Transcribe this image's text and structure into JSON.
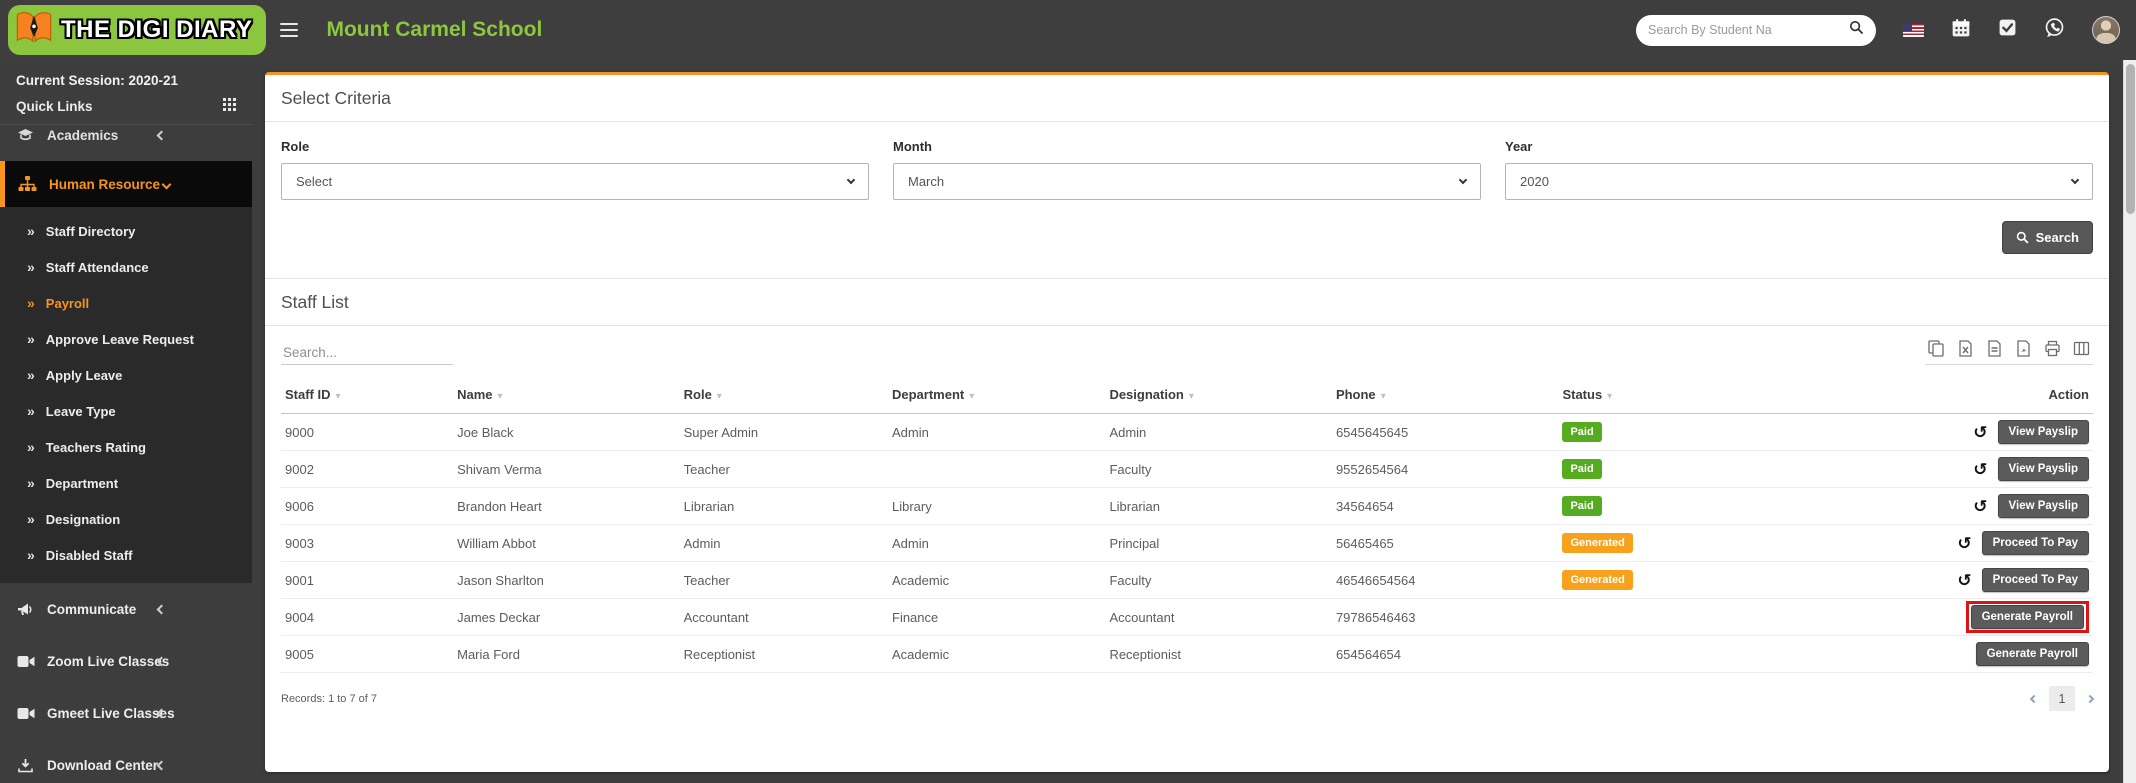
{
  "header": {
    "brand": "THE DIGI DIARY",
    "school": "Mount Carmel School",
    "search_placeholder": "Search By Student Na"
  },
  "sidebar": {
    "session": "Current Session: 2020-21",
    "quick_links": "Quick Links",
    "academics": "Academics",
    "human_resource": "Human Resource",
    "submenu": [
      "Staff Directory",
      "Staff Attendance",
      "Payroll",
      "Approve Leave Request",
      "Apply Leave",
      "Leave Type",
      "Teachers Rating",
      "Department",
      "Designation",
      "Disabled Staff"
    ],
    "bottom": [
      "Communicate",
      "Zoom Live Classes",
      "Gmeet Live Classes",
      "Download Center"
    ]
  },
  "criteria": {
    "title": "Select Criteria",
    "fields": [
      {
        "label": "Role",
        "value": "Select"
      },
      {
        "label": "Month",
        "value": "March"
      },
      {
        "label": "Year",
        "value": "2020"
      }
    ],
    "search_button": "Search"
  },
  "staff": {
    "title": "Staff List",
    "search_placeholder": "Search...",
    "columns": [
      "Staff ID",
      "Name",
      "Role",
      "Department",
      "Designation",
      "Phone",
      "Status",
      "Action"
    ],
    "rows": [
      {
        "id": "9000",
        "name": "Joe Black",
        "role": "Super Admin",
        "department": "Admin",
        "designation": "Admin",
        "phone": "6545645645",
        "status": "Paid",
        "action": "View Payslip"
      },
      {
        "id": "9002",
        "name": "Shivam Verma",
        "role": "Teacher",
        "department": "",
        "designation": "Faculty",
        "phone": "9552654564",
        "status": "Paid",
        "action": "View Payslip"
      },
      {
        "id": "9006",
        "name": "Brandon Heart",
        "role": "Librarian",
        "department": "Library",
        "designation": "Librarian",
        "phone": "34564654",
        "status": "Paid",
        "action": "View Payslip"
      },
      {
        "id": "9003",
        "name": "William Abbot",
        "role": "Admin",
        "department": "Admin",
        "designation": "Principal",
        "phone": "56465465",
        "status": "Generated",
        "action": "Proceed To Pay"
      },
      {
        "id": "9001",
        "name": "Jason Sharlton",
        "role": "Teacher",
        "department": "Academic",
        "designation": "Faculty",
        "phone": "46546654564",
        "status": "Generated",
        "action": "Proceed To Pay"
      },
      {
        "id": "9004",
        "name": "James Deckar",
        "role": "Accountant",
        "department": "Finance",
        "designation": "Accountant",
        "phone": "79786546463",
        "status": "",
        "action": "Generate Payroll"
      },
      {
        "id": "9005",
        "name": "Maria Ford",
        "role": "Receptionist",
        "department": "Academic",
        "designation": "Receptionist",
        "phone": "654564654",
        "status": "",
        "action": "Generate Payroll"
      }
    ],
    "records": "Records: 1 to 7 of 7",
    "page": "1"
  },
  "icons": {
    "submenu_arrow": "»",
    "sort_caret": "▾",
    "undo": "↺"
  },
  "colors": {
    "brand_green": "#8dc63f",
    "accent_orange": "#f7941e",
    "paid_green": "#56ab21",
    "generated_orange": "#f7a11c",
    "highlight_red": "#e01212"
  }
}
